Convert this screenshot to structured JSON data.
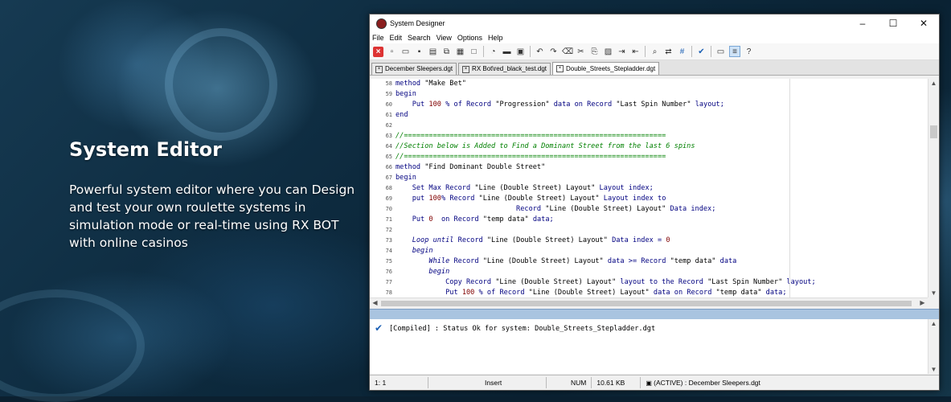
{
  "hero": {
    "title": "System Editor",
    "description": "Powerful system editor where you can Design and test your own roulette systems in simulation mode or real-time using RX BOT with online casinos"
  },
  "window": {
    "title": "System Designer",
    "controls": {
      "minimize": "–",
      "maximize": "☐",
      "close": "✕"
    }
  },
  "menu": [
    "File",
    "Edit",
    "Search",
    "View",
    "Options",
    "Help"
  ],
  "tabs": [
    {
      "label": "December Sleepers.dgt",
      "active": false
    },
    {
      "label": "RX Bot\\red_black_test.dgt",
      "active": false
    },
    {
      "label": "Double_Streets_Stepladder.dgt",
      "active": true
    }
  ],
  "code_lines": [
    {
      "n": "58",
      "html": "<span class=\"kw\">method</span> \"Make Bet\""
    },
    {
      "n": "59",
      "html": "<span class=\"kw\">begin</span>"
    },
    {
      "n": "60",
      "html": "    <span class=\"kw\">Put</span> <span class=\"nm\">100</span> <span class=\"kw\">%</span> <span class=\"kw\">of</span> <span class=\"kw\">Record</span> \"Progression\" <span class=\"kw\">data</span> <span class=\"kw\">on</span> <span class=\"kw\">Record</span> \"Last Spin Number\" <span class=\"kw\">layout;</span>"
    },
    {
      "n": "61",
      "html": "<span class=\"kw\">end</span>"
    },
    {
      "n": "62",
      "html": ""
    },
    {
      "n": "63",
      "html": "<span class=\"cm\">//===============================================================</span>"
    },
    {
      "n": "64",
      "html": "<span class=\"cm\">//Section below is Added to Find a Dominant Street from the last 6 spins</span>"
    },
    {
      "n": "65",
      "html": "<span class=\"cm\">//===============================================================</span>"
    },
    {
      "n": "66",
      "html": "<span class=\"kw\">method</span> \"Find Dominant Double Street\""
    },
    {
      "n": "67",
      "html": "<span class=\"kw\">begin</span>"
    },
    {
      "n": "68",
      "html": "    <span class=\"kw\">Set Max</span> <span class=\"kw\">Record</span> \"Line (Double Street) Layout\" <span class=\"kw\">Layout index;</span>"
    },
    {
      "n": "69",
      "html": "    <span class=\"kw\">put</span> <span class=\"nm\">100</span><span class=\"kw\">%</span> <span class=\"kw\">Record</span> \"Line (Double Street) Layout\" <span class=\"kw\">Layout index</span> <span class=\"kw\">to</span>"
    },
    {
      "n": "70",
      "html": "                             <span class=\"kw\">Record</span> \"Line (Double Street) Layout\" <span class=\"kw\">Data index;</span>"
    },
    {
      "n": "71",
      "html": "    <span class=\"kw\">Put</span> <span class=\"nm\">0</span>  <span class=\"kw\">on</span> <span class=\"kw\">Record</span> \"temp data\" <span class=\"kw\">data;</span>"
    },
    {
      "n": "72",
      "html": ""
    },
    {
      "n": "73",
      "html": "    <span class=\"kw\"><i>Loop until</i></span> <span class=\"kw\">Record</span> \"Line (Double Street) Layout\" <span class=\"kw\">Data index</span> <span class=\"kw\">=</span> <span class=\"nm\">0</span>"
    },
    {
      "n": "74",
      "html": "    <span class=\"kw\"><i>begin</i></span>"
    },
    {
      "n": "75",
      "html": "        <span class=\"kw\"><i>While</i></span> <span class=\"kw\">Record</span> \"Line (Double Street) Layout\" <span class=\"kw\">data</span> <span class=\"kw\">&gt;=</span> <span class=\"kw\">Record</span> \"temp data\" <span class=\"kw\">data</span>"
    },
    {
      "n": "76",
      "html": "        <span class=\"kw\"><i>begin</i></span>"
    },
    {
      "n": "77",
      "html": "            <span class=\"kw\">Copy</span> <span class=\"kw\">Record</span> \"Line (Double Street) Layout\" <span class=\"kw\">layout</span> <span class=\"kw\">to the</span> <span class=\"kw\">Record</span> \"Last Spin Number\" <span class=\"kw\">layout;</span>"
    },
    {
      "n": "78",
      "html": "            <span class=\"kw\">Put</span> <span class=\"nm\">100</span> <span class=\"kw\">%</span> <span class=\"kw\">of</span> <span class=\"kw\">Record</span> \"Line (Double Street) Layout\" <span class=\"kw\">data</span> <span class=\"kw\">on</span> <span class=\"kw\">Record</span> \"temp data\" <span class=\"kw\">data;</span>"
    }
  ],
  "output": {
    "message": "[Compiled] : Status Ok for system: Double_Streets_Stepladder.dgt"
  },
  "status": {
    "position": "1: 1",
    "mode": "Insert",
    "num": "NUM",
    "size": "10.61 KB",
    "active_file": "(ACTIVE) : December Sleepers.dgt"
  }
}
